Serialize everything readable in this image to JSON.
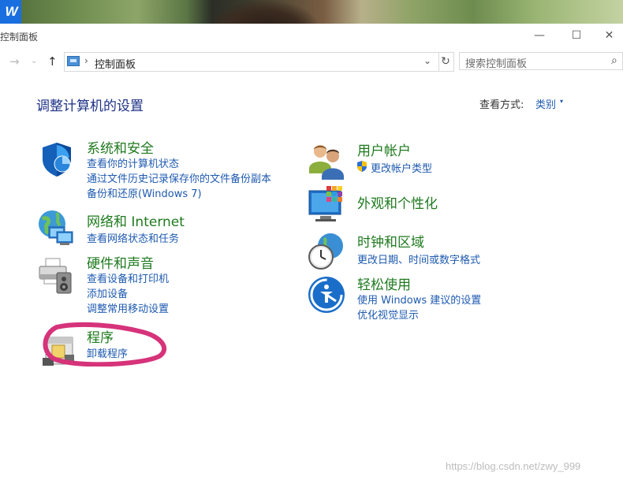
{
  "desktop": {
    "app_logo": "W",
    "logo_color": "#1a6fe0"
  },
  "window": {
    "title": "控制面板",
    "minimize_glyph": "—",
    "maximize_glyph": "☐",
    "close_glyph": "✕"
  },
  "nav": {
    "back_glyph": "→",
    "recent_glyph": "⌄",
    "up_glyph": "↑",
    "breadcrumb_sep": "›",
    "address": "控制面板",
    "address_drop_glyph": "⌄",
    "refresh_glyph": "↻",
    "search_placeholder": "搜索控制面板",
    "search_icon_glyph": "⌕"
  },
  "content": {
    "heading": "调整计算机的设置",
    "view_by_label": "查看方式:",
    "view_by_value": "类别",
    "view_by_caret": "▾"
  },
  "left_categories": [
    {
      "title": "系统和安全",
      "icon": "shield-icon",
      "links": [
        "查看你的计算机状态",
        "通过文件历史记录保存你的文件备份副本",
        "备份和还原(Windows 7)"
      ]
    },
    {
      "title": "网络和 Internet",
      "icon": "network-globe-icon",
      "links": [
        "查看网络状态和任务"
      ]
    },
    {
      "title": "硬件和声音",
      "icon": "printer-speaker-icon",
      "links": [
        "查看设备和打印机",
        "添加设备",
        "调整常用移动设置"
      ]
    },
    {
      "title": "程序",
      "icon": "programs-icon",
      "links": [
        "卸载程序"
      ]
    }
  ],
  "right_categories": [
    {
      "title": "用户帐户",
      "icon": "users-icon",
      "links": [
        "更改帐户类型"
      ],
      "link_icon": "uac-shield-icon"
    },
    {
      "title": "外观和个性化",
      "icon": "monitor-palette-icon",
      "links": []
    },
    {
      "title": "时钟和区域",
      "icon": "clock-globe-icon",
      "links": [
        "更改日期、时间或数字格式"
      ]
    },
    {
      "title": "轻松使用",
      "icon": "ease-of-access-icon",
      "links": [
        "使用 Windows 建议的设置",
        "优化视觉显示"
      ]
    }
  ],
  "annotation_color": "#d6337a",
  "watermark": "https://blog.csdn.net/zwy_999"
}
